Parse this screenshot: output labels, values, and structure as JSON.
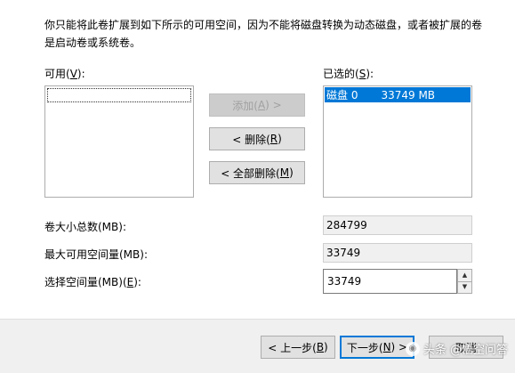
{
  "description": "你只能将此卷扩展到如下所示的可用空间，因为不能将磁盘转换为动态磁盘，或者被扩展的卷是启动卷或系统卷。",
  "available": {
    "label": "可用(",
    "accel": "V",
    "label_end": "):",
    "items": []
  },
  "selected": {
    "label": "已选的(",
    "accel": "S",
    "label_end": "):",
    "items": [
      {
        "disk": "磁盘 0",
        "size": "33749 MB"
      }
    ]
  },
  "buttons": {
    "add": {
      "text": "添加(",
      "accel": "A",
      "text_end": ") >"
    },
    "remove": {
      "text": "< 删除(",
      "accel": "R",
      "text_end": ")"
    },
    "remove_all": {
      "text": "< 全部删除(",
      "accel": "M",
      "text_end": ")"
    },
    "back": {
      "text": "< 上一步(",
      "accel": "B",
      "text_end": ")"
    },
    "next": {
      "text": "下一步(",
      "accel": "N",
      "text_end": ") >"
    },
    "cancel": "取消"
  },
  "fields": {
    "total_label": "卷大小总数(MB):",
    "total_value": "284799",
    "max_label": "最大可用空间量(MB):",
    "max_value": "33749",
    "select_label": "选择空间量(MB)(",
    "select_accel": "E",
    "select_label_end": "):",
    "select_value": "33749"
  },
  "watermark": {
    "text": "头条 @悟空问答"
  }
}
